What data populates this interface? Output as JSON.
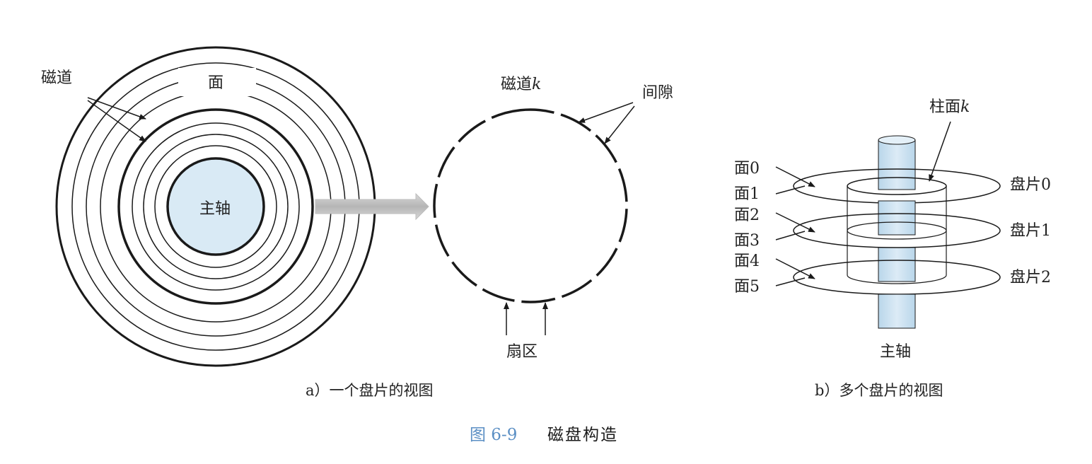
{
  "panel_a": {
    "label_track": "磁道",
    "label_surface": "面",
    "label_spindle": "主轴",
    "label_track_k": "磁道",
    "label_track_k_var": "k",
    "label_gap": "间隙",
    "label_sector": "扇区",
    "caption": "a）一个盘片的视图"
  },
  "panel_b": {
    "label_cylinder": "柱面",
    "label_cylinder_var": "k",
    "surfaces": [
      "面0",
      "面1",
      "面2",
      "面3",
      "面4",
      "面5"
    ],
    "platters": [
      "盘片0",
      "盘片1",
      "盘片2"
    ],
    "label_spindle": "主轴",
    "caption": "b）多个盘片的视图"
  },
  "figure": {
    "number": "图 6-9",
    "title": "磁盘构造"
  },
  "colors": {
    "spindle_fill": "#cfe3f1",
    "figure_number": "#5b8fc4",
    "ink": "#1a1a1a"
  }
}
